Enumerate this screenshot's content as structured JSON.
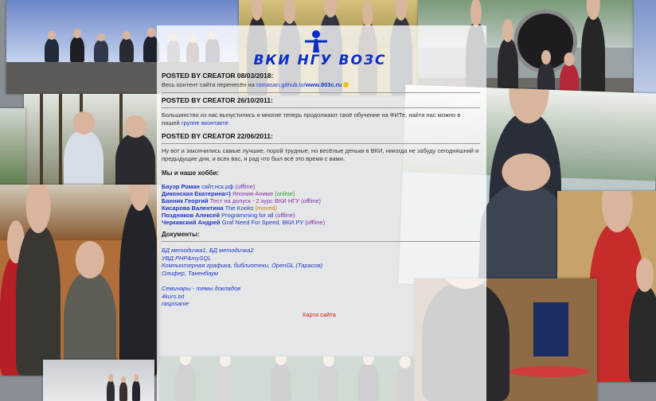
{
  "logo": {
    "text": "ВКИ НГУ ВОЗС"
  },
  "posts": [
    {
      "header": "POSTED BY CREATOR 08/03/2018:",
      "text_before": "Весь контент сайта перенесён на ",
      "link1": "romasan.github.io/",
      "link2": "www.803c.ru",
      "text_after": " "
    },
    {
      "header": "POSTED BY CREATOR 26/10/2011:",
      "text_before": "Большинство из нас выпустились и многие теперь продолжают своё обучение на ФИТе, найти нас можно в нашей ",
      "link1": "группе вконтакте",
      "text_after": ""
    },
    {
      "header": "POSTED BY CREATOR 22/06/2011:",
      "text": "Ну вот и закончились самые лучшие, порой трудные, но весёлые деньки в ВКИ, никогда не забуду сегодняшний и предыдущие дни, и всех вас, я рад что был всё это время с вами."
    }
  ],
  "members_title": "Мы и наше хобби:",
  "members": [
    {
      "name": "Бауэр Роман",
      "hobby": "сайт.нск.рф",
      "status": "(offline)",
      "state": "offline"
    },
    {
      "name": "Диконская Екатерина=)",
      "hobby": "Япония-Аниме",
      "status": "(online)",
      "state": "online"
    },
    {
      "name": "Банник Георгий",
      "hobby": "Тест на допуск - 2 курс ВКИ НГУ",
      "status": "(offline)",
      "state": "offline"
    },
    {
      "name": "Кисарова Валентина",
      "hobby": "The Kooks",
      "status": "(moved)",
      "state": "moved"
    },
    {
      "name": "Поздняков Алексей",
      "hobby": "Programming for all",
      "status": "(offline)",
      "state": "offline"
    },
    {
      "name": "Черкавский Андрей",
      "hobby": "Graf Need For Speed, ВКИ.РУ",
      "status": "(offline)",
      "state": "offline"
    }
  ],
  "docs_title": "Документы:",
  "docs_group1": [
    "БД методичка1, БД методичка2",
    "УВД PHP&mySQL",
    "Компьютерная графика, библиотеки, OpenGL (Тарасов)",
    "Олифер, Таненбаум"
  ],
  "docs_group2": [
    "Семинары - темы докладов",
    "4kurs.txt",
    "raspisanie"
  ],
  "sitemap": "Карта сайта",
  "icons": {
    "logo_figure": "person-icon",
    "smile": "smile-icon"
  },
  "colors": {
    "link": "#1d35c9",
    "online": "#1d9a2a",
    "offline": "#7b2fa8",
    "moved": "#c97a1d",
    "sitemap": "#d11a1a",
    "logo": "#0a2fc9"
  }
}
